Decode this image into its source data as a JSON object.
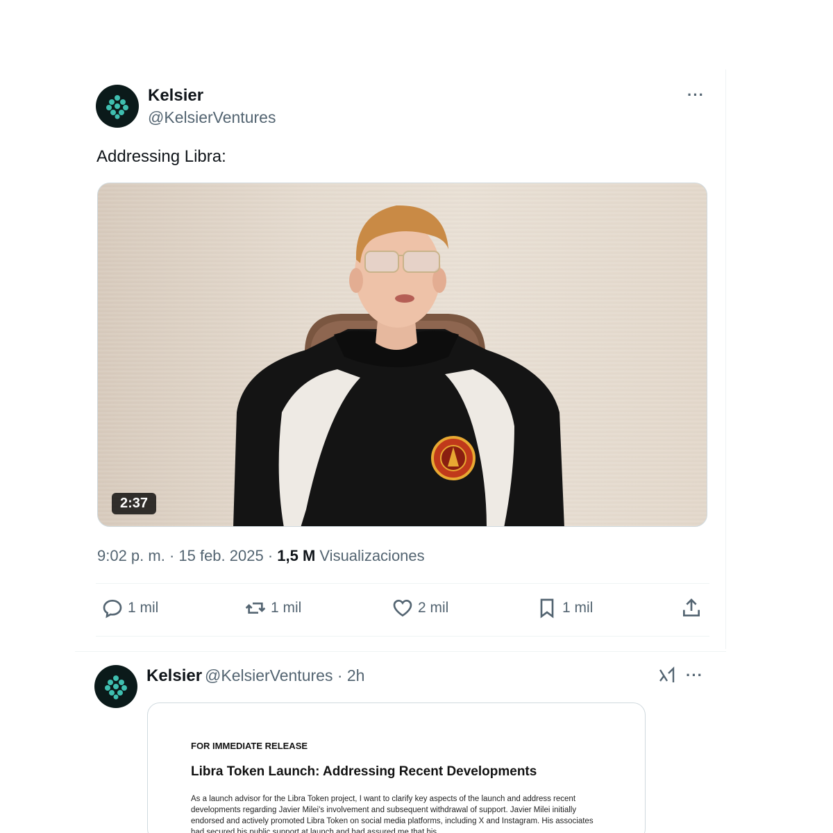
{
  "tweet": {
    "author_name": "Kelsier",
    "author_handle": "@KelsierVentures",
    "text": "Addressing Libra:",
    "more_label": "···",
    "video": {
      "duration": "2:37"
    },
    "meta": {
      "time": "9:02 p. m. · 15 feb. 2025 · ",
      "views_count": "1,5 M",
      "views_label": " Visualizaciones"
    },
    "actions": {
      "replies": "1 mil",
      "reposts": "1 mil",
      "likes": "2 mil",
      "bookmarks": "1 mil"
    }
  },
  "quoted_tweet": {
    "author_name": "Kelsier",
    "author_handle_time": "@KelsierVentures · 2h",
    "more_label": "···",
    "document": {
      "release_label": "FOR IMMEDIATE RELEASE",
      "title": "Libra Token Launch: Addressing Recent Developments",
      "body": "As a launch advisor for the Libra Token project, I want to clarify key aspects of the launch and address recent developments regarding Javier Milei's involvement and subsequent withdrawal of support. Javier Milei initially endorsed and actively promoted Libra Token on social media platforms, including X and Instagram. His associates had secured his public support at launch and had assured me that his"
    }
  },
  "colors": {
    "text_primary": "#0f1419",
    "text_secondary": "#536471",
    "border": "#eff3f4",
    "avatar_accent": "#3fbfb0"
  },
  "icons": [
    "reply-icon",
    "repost-icon",
    "like-icon",
    "bookmark-icon",
    "share-icon",
    "grok-icon",
    "more-icon"
  ]
}
